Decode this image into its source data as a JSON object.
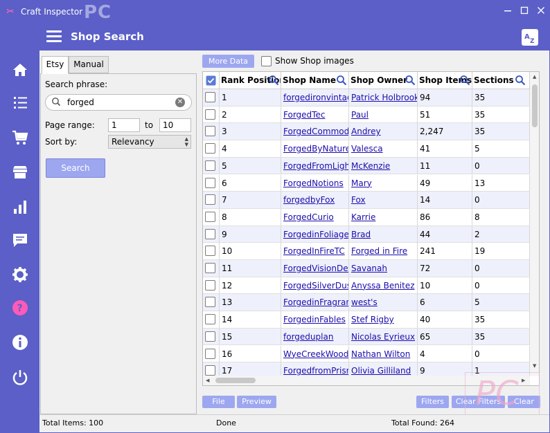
{
  "app": {
    "title": "Craft Inspector",
    "watermark": "PC"
  },
  "header": {
    "title": "Shop Search",
    "translate_icon": "translate-icon"
  },
  "nav": [
    "home-icon",
    "list-icon",
    "cart-icon",
    "store-icon",
    "chart-icon",
    "message-icon",
    "settings-icon",
    "help-icon",
    "info-icon",
    "power-icon"
  ],
  "left": {
    "tabs": [
      "Etsy",
      "Manual"
    ],
    "search_label": "Search phrase:",
    "search_value": "forged",
    "page_range_label": "Page range:",
    "page_from": "1",
    "to_label": "to",
    "page_to": "10",
    "sort_label": "Sort by:",
    "sort_value": "Relevancy",
    "search_button": "Search"
  },
  "toolbar": {
    "more_data": "More Data",
    "show_images": "Show Shop images"
  },
  "columns": [
    "Rank Position",
    "Shop Name",
    "Shop Owner",
    "Shop Items",
    "Sections"
  ],
  "rows": [
    {
      "rank": "1",
      "name": "forgedironvintage",
      "owner": "Patrick Holbrook",
      "items": "94",
      "sections": "35",
      "checked": false
    },
    {
      "rank": "2",
      "name": "ForgedTec",
      "owner": "Paul",
      "items": "51",
      "sections": "35",
      "checked": false
    },
    {
      "rank": "3",
      "name": "ForgedCommodities",
      "owner": "Andrey",
      "items": "2,247",
      "sections": "35",
      "checked": false
    },
    {
      "rank": "4",
      "name": "ForgedByNatureShop",
      "owner": "Valesca",
      "items": "41",
      "sections": "5",
      "checked": false
    },
    {
      "rank": "5",
      "name": "ForgedFromLight",
      "owner": "McKenzie",
      "items": "11",
      "sections": "0",
      "checked": false
    },
    {
      "rank": "6",
      "name": "ForgedNotions",
      "owner": "Mary",
      "items": "49",
      "sections": "13",
      "checked": false
    },
    {
      "rank": "7",
      "name": "forgedbyFox",
      "owner": "Fox",
      "items": "14",
      "sections": "0",
      "checked": false
    },
    {
      "rank": "8",
      "name": "ForgedCurio",
      "owner": "Karrie",
      "items": "86",
      "sections": "8",
      "checked": false
    },
    {
      "rank": "9",
      "name": "ForgedinFoliage",
      "owner": "Brad",
      "items": "44",
      "sections": "2",
      "checked": false
    },
    {
      "rank": "10",
      "name": "ForgedInFireTC",
      "owner": "Forged in Fire",
      "items": "241",
      "sections": "19",
      "checked": false
    },
    {
      "rank": "11",
      "name": "ForgedVisionDesigns",
      "owner": "Savanah",
      "items": "72",
      "sections": "0",
      "checked": false
    },
    {
      "rank": "12",
      "name": "ForgedSilverDust",
      "owner": "Anyssa Benitez",
      "items": "10",
      "sections": "0",
      "checked": false
    },
    {
      "rank": "13",
      "name": "ForgedinFragrance",
      "owner": "west's",
      "items": "6",
      "sections": "5",
      "checked": false
    },
    {
      "rank": "14",
      "name": "ForgedinFables",
      "owner": "Stef Rigby",
      "items": "40",
      "sections": "35",
      "checked": false
    },
    {
      "rank": "15",
      "name": "forgeduplan",
      "owner": "Nicolas Eyrieux",
      "items": "65",
      "sections": "35",
      "checked": false
    },
    {
      "rank": "16",
      "name": "WyeCreekWoodworks",
      "owner": "Nathan Wilton",
      "items": "4",
      "sections": "0",
      "checked": false
    },
    {
      "rank": "17",
      "name": "ForgedfromPrism",
      "owner": "Olivia Gilliland",
      "items": "9",
      "sections": "1",
      "checked": false
    }
  ],
  "buttons": {
    "file": "File",
    "preview": "Preview",
    "filters": "Filters",
    "clear_filters": "Clear Filters",
    "clear": "Clear"
  },
  "status": {
    "total_items": "Total Items: 100",
    "state": "Done",
    "total_found": "Total Found: 264"
  },
  "colors": {
    "accent": "#5b5fc7",
    "button": "#9da7f0",
    "link": "#1a0dab"
  }
}
